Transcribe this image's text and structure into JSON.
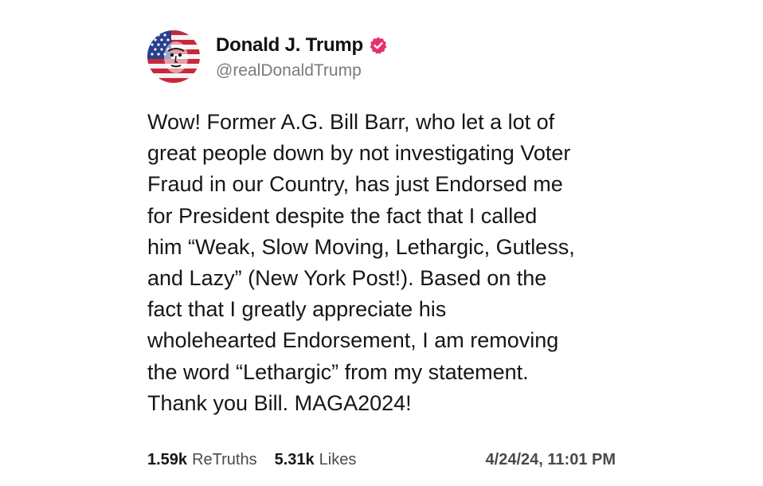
{
  "author": {
    "display_name": "Donald J. Trump",
    "handle": "@realDonaldTrump",
    "verified_icon": "verified-badge-icon",
    "verified_color": "#e6316b",
    "avatar_icon": "flag-portrait-avatar"
  },
  "post": {
    "lines": [
      "Wow! Former A.G. Bill Barr, who let a lot of",
      "great people down by not investigating Voter",
      "Fraud in our Country, has just Endorsed me",
      "for President despite the fact that I called",
      "him “Weak, Slow Moving, Lethargic, Gutless,",
      "and Lazy” (New York Post!). Based on the",
      "fact that I greatly appreciate his",
      "wholehearted Endorsement, I am removing",
      "the word “Lethargic” from my statement.",
      "Thank you Bill. MAGA2024!"
    ]
  },
  "stats": {
    "retruths_count": "1.59k",
    "retruths_label": "ReTruths",
    "likes_count": "5.31k",
    "likes_label": "Likes"
  },
  "timestamp": "4/24/24, 11:01 PM"
}
